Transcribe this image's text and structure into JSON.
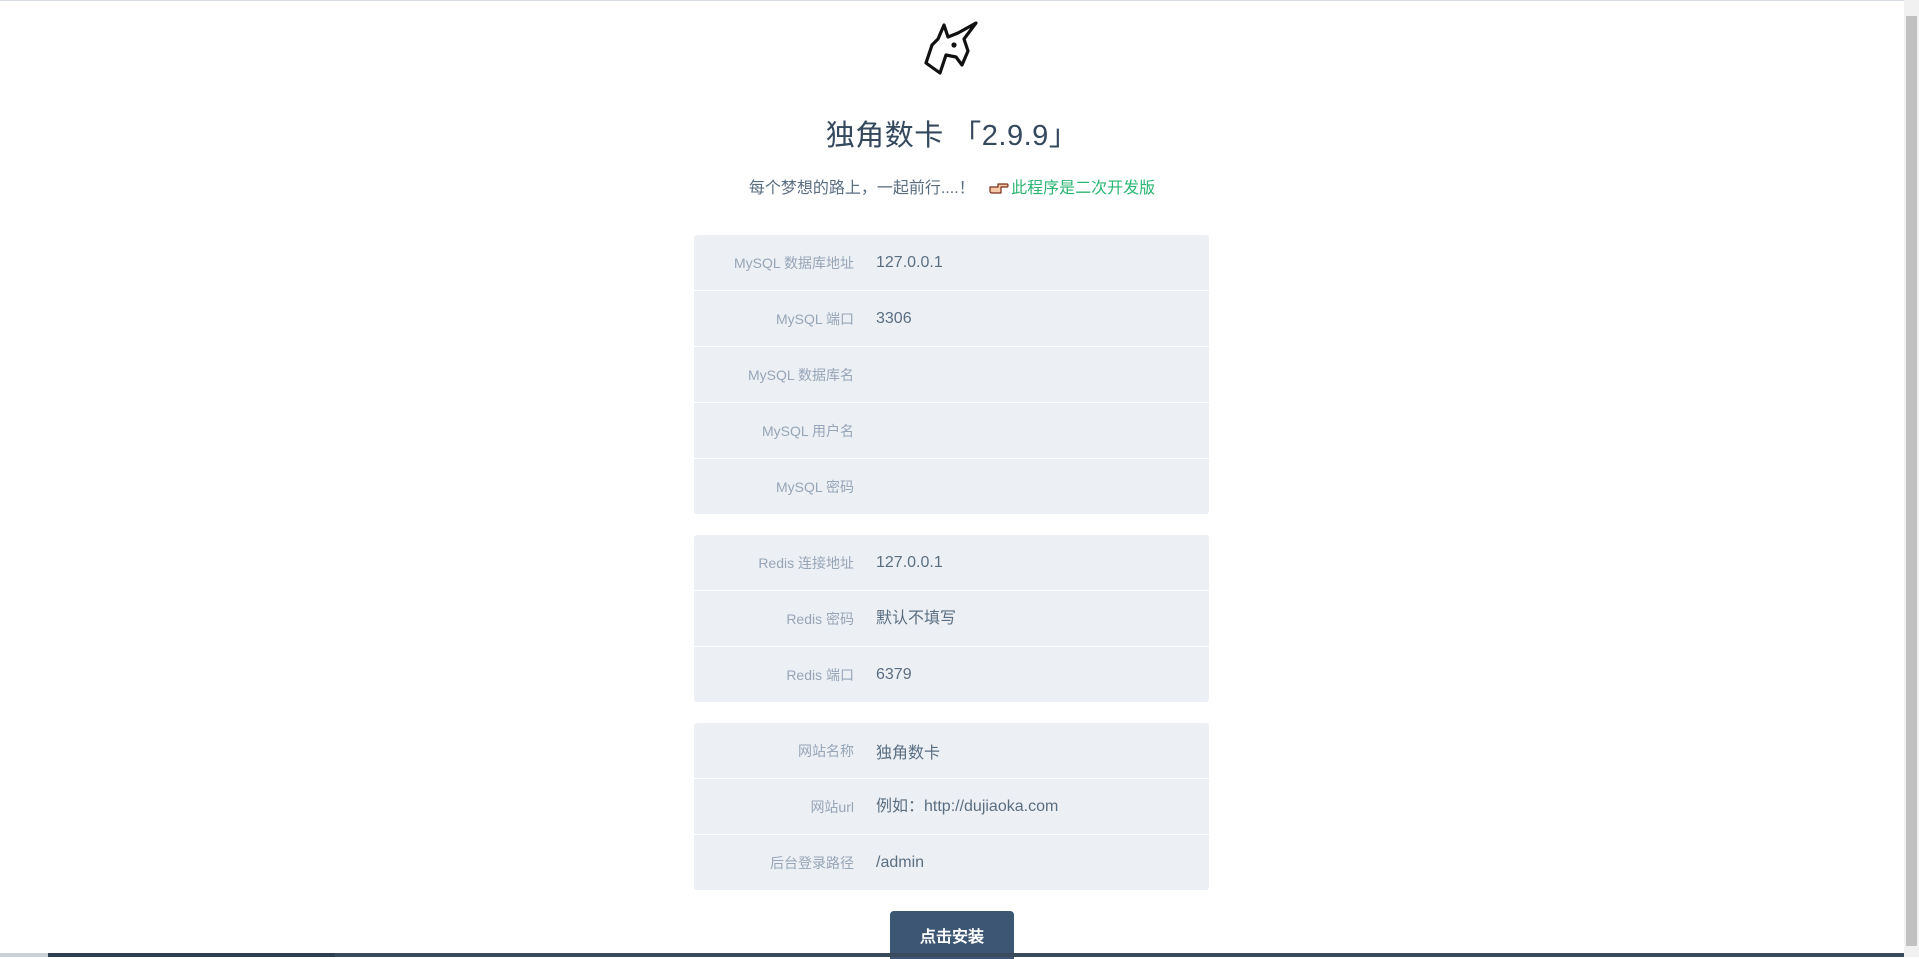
{
  "header": {
    "logo_icon": "unicorn-icon",
    "title": "独角数卡 「2.9.9」",
    "subtitle": "每个梦想的路上，一起前行....！",
    "hand_icon": "pointing-hand-icon",
    "link_text": "此程序是二次开发版"
  },
  "mysql": {
    "host": {
      "label": "MySQL 数据库地址",
      "value": "127.0.0.1"
    },
    "port": {
      "label": "MySQL 端口",
      "value": "3306"
    },
    "dbname": {
      "label": "MySQL 数据库名",
      "value": ""
    },
    "user": {
      "label": "MySQL 用户名",
      "value": ""
    },
    "password": {
      "label": "MySQL 密码",
      "value": ""
    }
  },
  "redis": {
    "host": {
      "label": "Redis 连接地址",
      "value": "127.0.0.1"
    },
    "password": {
      "label": "Redis 密码",
      "placeholder": "默认不填写"
    },
    "port": {
      "label": "Redis 端口",
      "value": "6379"
    }
  },
  "site": {
    "name": {
      "label": "网站名称",
      "value": "独角数卡"
    },
    "url": {
      "label": "网站url",
      "placeholder": "例如：http://dujiaoka.com"
    },
    "admin_path": {
      "label": "后台登录路径",
      "value": "/admin"
    }
  },
  "install_button": "点击安装",
  "colors": {
    "accent_link": "#2bb673",
    "button_bg": "#3d5673",
    "group_bg": "#ecf0f4",
    "label": "#96a5b8"
  }
}
